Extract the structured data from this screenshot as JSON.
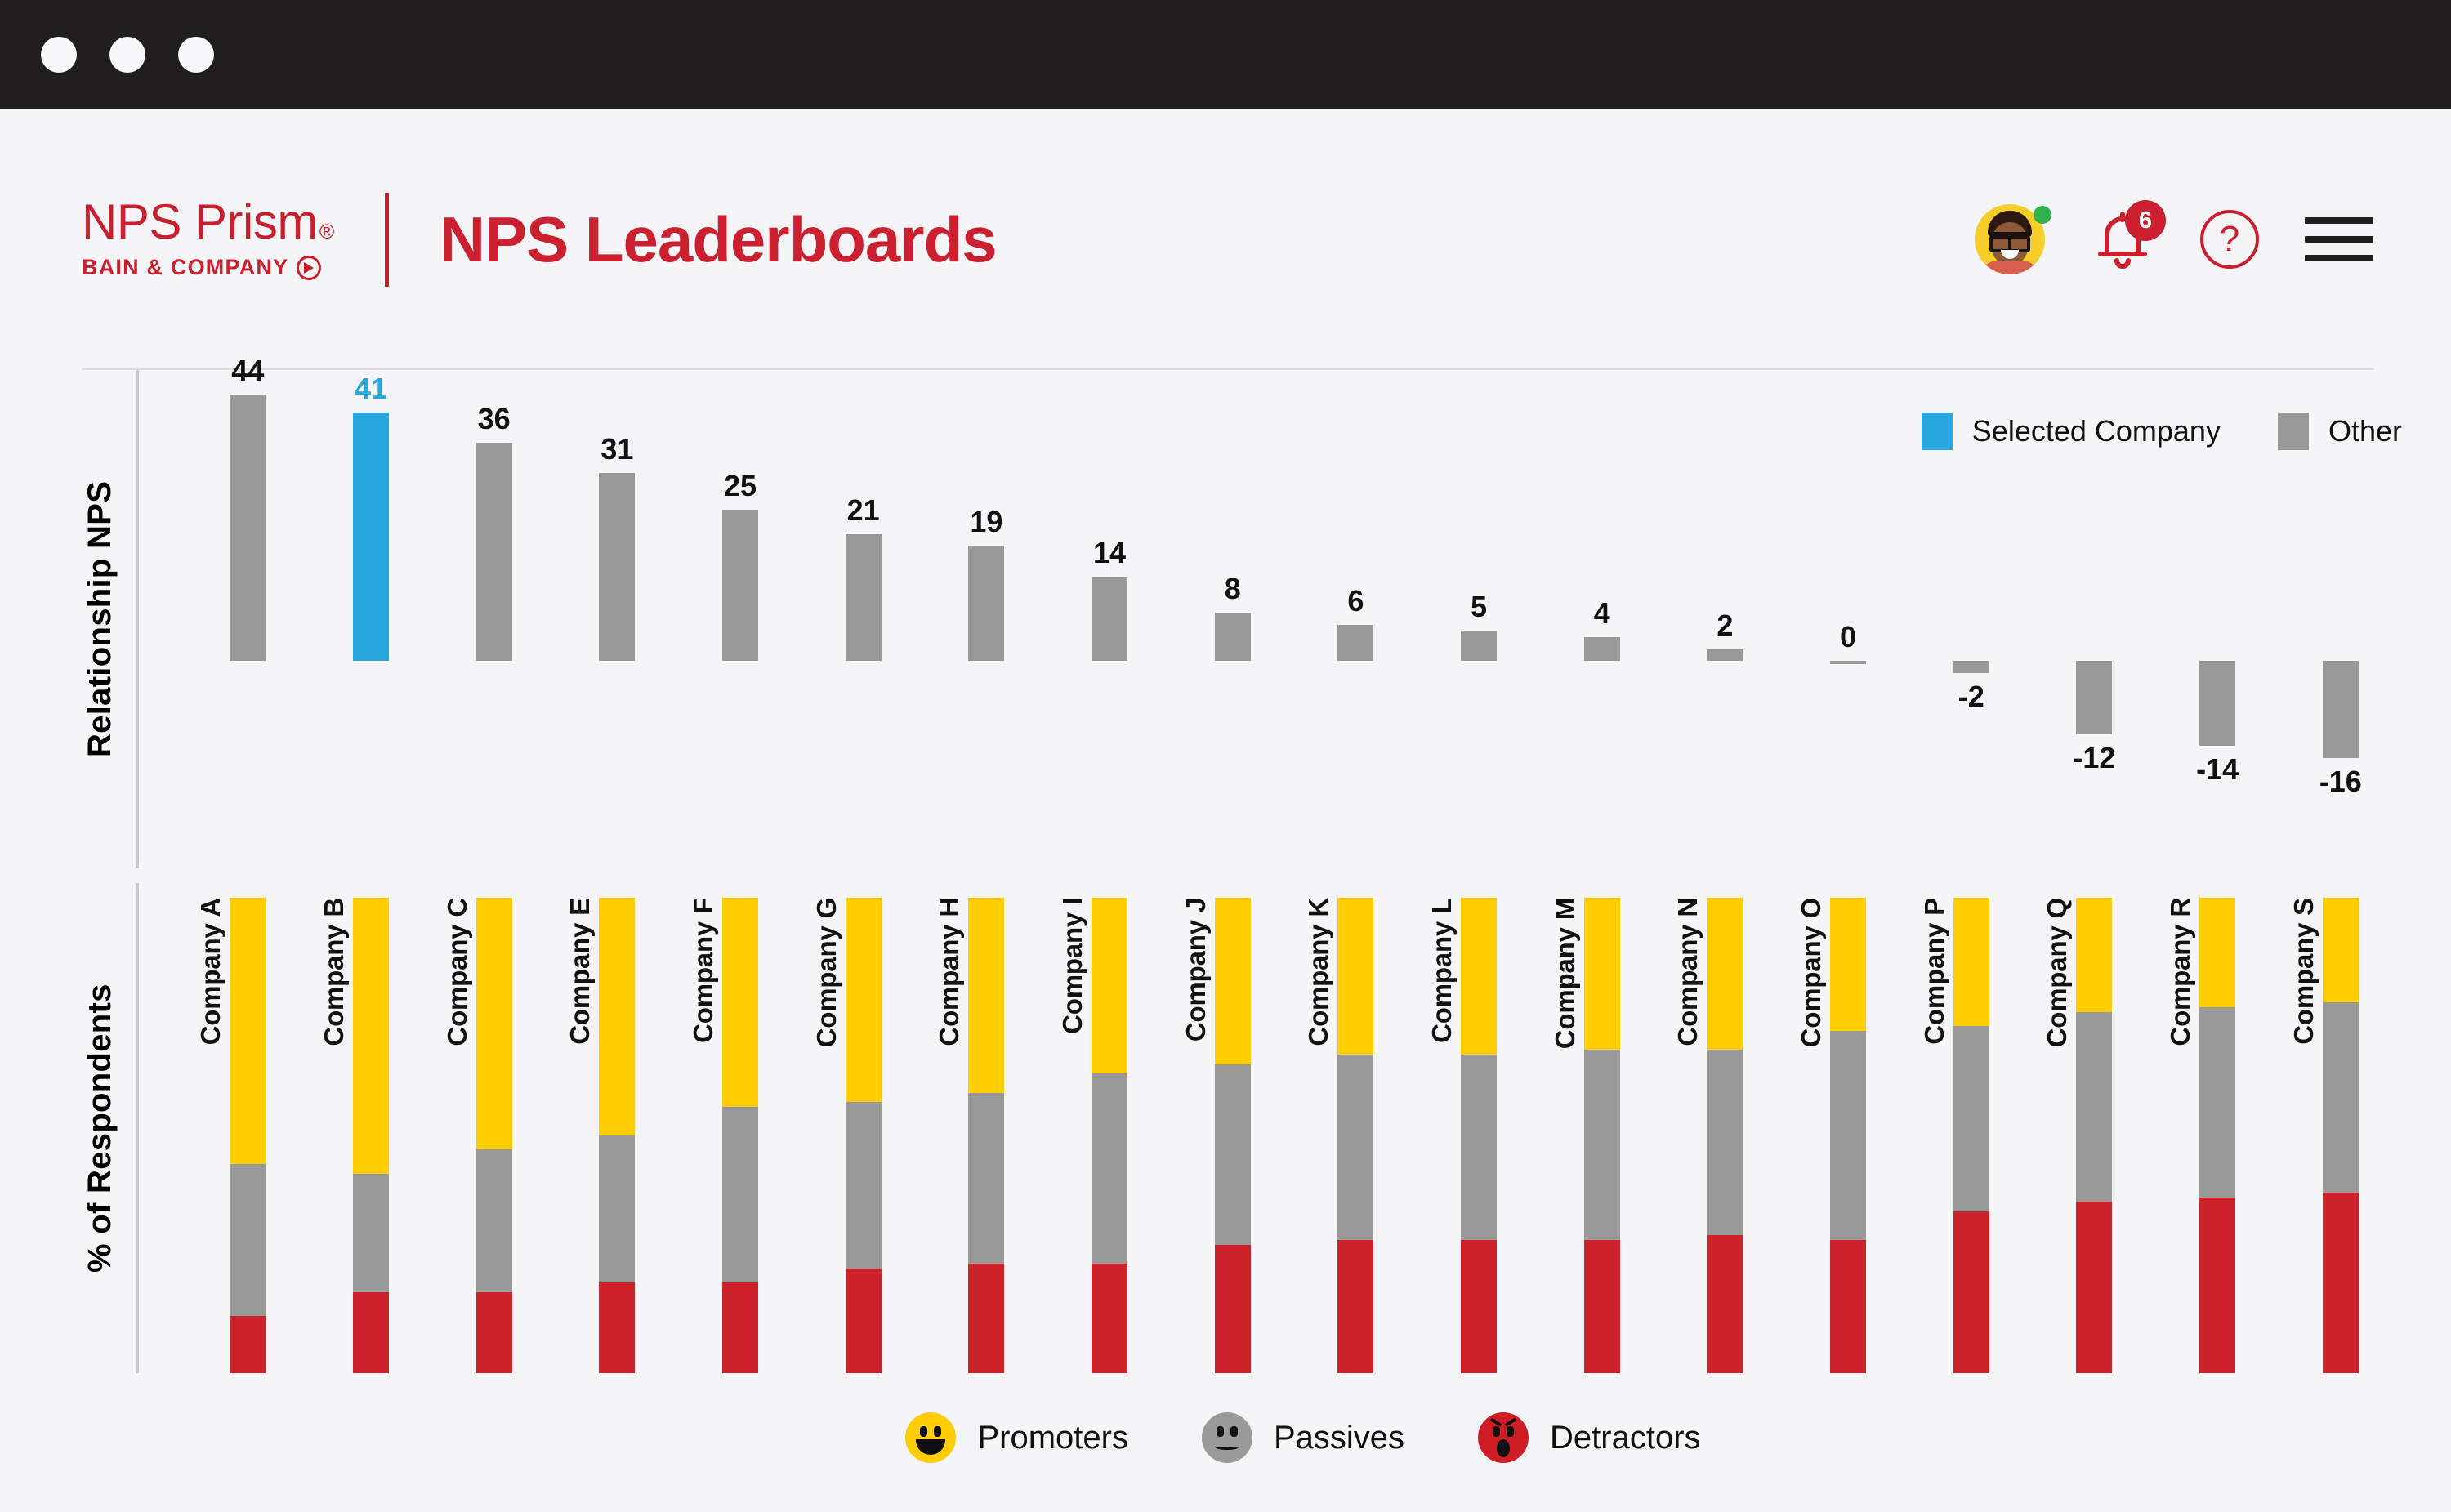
{
  "window": {
    "dots": [
      "close-dot",
      "minimize-dot",
      "maximize-dot"
    ]
  },
  "header": {
    "brand_name": "NPS Prism",
    "brand_reg": "®",
    "brand_sub": "BAIN & COMPANY",
    "title": "NPS Leaderboards",
    "notification_count": "6",
    "help_glyph": "?",
    "avatar_status": "online"
  },
  "chart_data": [
    {
      "type": "bar",
      "title": "Relationship NPS",
      "ylabel": "Relationship NPS",
      "xlabel": "",
      "categories": [
        "Company A",
        "Company B",
        "Company C",
        "Company E",
        "Company F",
        "Company G",
        "Company H",
        "Company I",
        "Company J",
        "Company K",
        "Company L",
        "Company M",
        "Company N",
        "Company O",
        "Company P",
        "Company Q",
        "Company R",
        "Company S"
      ],
      "values": [
        44,
        41,
        36,
        31,
        25,
        21,
        19,
        14,
        8,
        6,
        5,
        4,
        2,
        0,
        -2,
        -12,
        -14,
        -16
      ],
      "highlight_index": 1,
      "ylim": [
        -20,
        48
      ],
      "grid": false,
      "legend_position": "top-right",
      "legend": [
        {
          "label": "Selected Company",
          "color": "#29A8E0"
        },
        {
          "label": "Other",
          "color": "#999999"
        }
      ]
    },
    {
      "type": "bar",
      "stacked": true,
      "title": "% of Respondents",
      "ylabel": "% of Respondents",
      "xlabel": "",
      "categories": [
        "Company A",
        "Company B",
        "Company C",
        "Company E",
        "Company F",
        "Company G",
        "Company H",
        "Company I",
        "Company J",
        "Company K",
        "Company L",
        "Company M",
        "Company N",
        "Company O",
        "Company P",
        "Company Q",
        "Company R",
        "Company S"
      ],
      "series": [
        {
          "name": "Promoters",
          "color": "#FFCD00",
          "values": [
            56,
            58,
            53,
            50,
            44,
            43,
            41,
            37,
            35,
            33,
            33,
            32,
            32,
            28,
            27,
            24,
            23,
            22
          ]
        },
        {
          "name": "Passives",
          "color": "#999999",
          "values": [
            32,
            25,
            30,
            31,
            37,
            35,
            36,
            40,
            38,
            39,
            39,
            40,
            39,
            44,
            39,
            40,
            40,
            40
          ]
        },
        {
          "name": "Detractors",
          "color": "#CC2229",
          "values": [
            12,
            17,
            17,
            19,
            19,
            22,
            23,
            23,
            27,
            28,
            28,
            28,
            29,
            28,
            34,
            36,
            37,
            38
          ]
        }
      ],
      "ylim": [
        0,
        100
      ],
      "grid": false,
      "legend_position": "bottom-center",
      "legend": [
        {
          "label": "Promoters",
          "color": "#FFCD00",
          "icon": "smiley-happy-icon"
        },
        {
          "label": "Passives",
          "color": "#9A9A9A",
          "icon": "smiley-neutral-icon"
        },
        {
          "label": "Detractors",
          "color": "#D01C24",
          "icon": "smiley-angry-icon"
        }
      ]
    }
  ],
  "colors": {
    "brand_red": "#CB2030",
    "selected_blue": "#29A8E0",
    "other_gray": "#999999",
    "promoter_yellow": "#FFCD00",
    "passive_gray": "#999999",
    "detractor_red": "#CC2229",
    "page_bg": "#F5F5F7",
    "titlebar_bg": "#201E1F",
    "online_green": "#2DB34A"
  }
}
